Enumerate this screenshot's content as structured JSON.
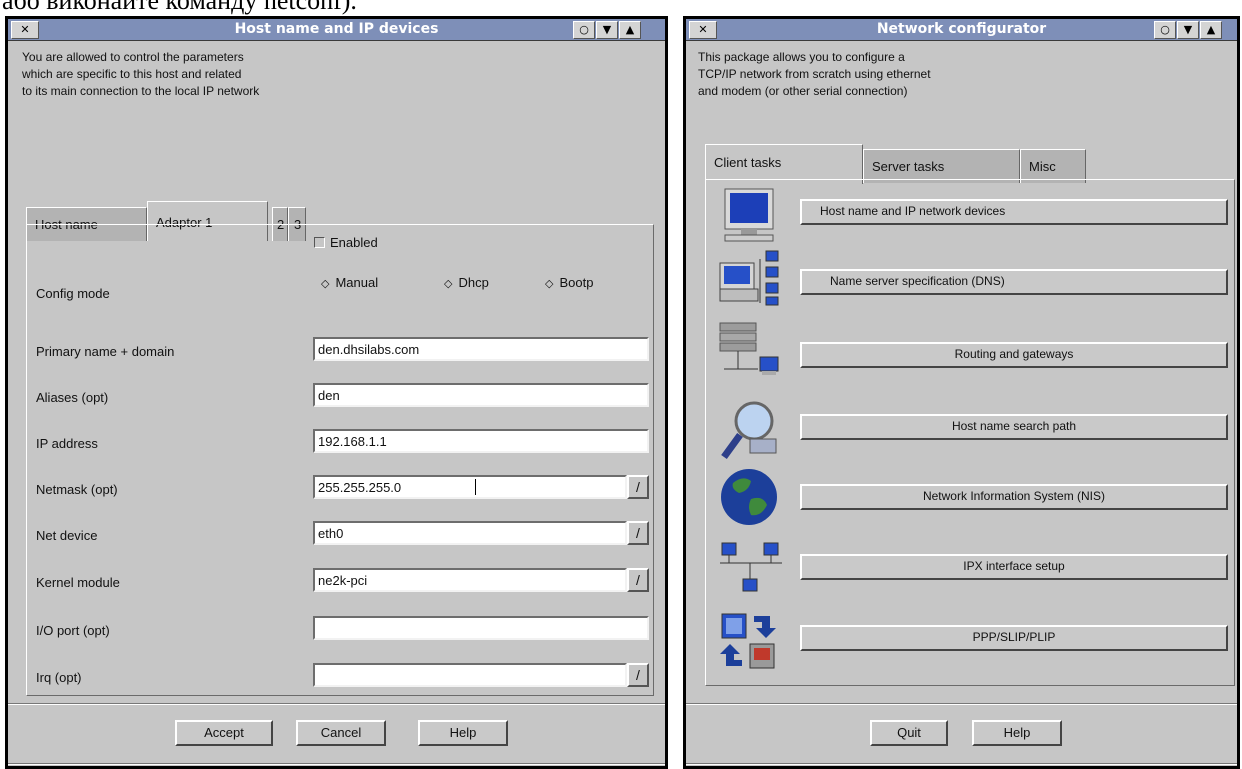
{
  "document": {
    "caption": "або виконайте команду netconf)."
  },
  "left_window": {
    "title": "Host name and IP devices",
    "close_glyph": "✕",
    "ctrl_glyphs": [
      "○",
      "▼",
      "▲"
    ],
    "intro": "You are allowed to control the parameters\nwhich are specific to this host and related\nto its main connection to the local IP network",
    "tabs": [
      "Host name",
      "Adaptor 1",
      "2",
      "3"
    ],
    "active_tab": "Adaptor 1",
    "enabled_label": "Enabled",
    "enabled_checked": false,
    "config_mode_label": "Config mode",
    "modes": [
      "Manual",
      "Dhcp",
      "Bootp"
    ],
    "selected_mode": "Manual",
    "fields": [
      {
        "label": "Primary name + domain",
        "value": ""
      },
      {
        "label": "Aliases (opt)",
        "value": "den"
      },
      {
        "label": "IP address",
        "value": "192.168.1.1"
      },
      {
        "label": "Netmask (opt)",
        "value": "255.255.255.0"
      },
      {
        "label": "Net device",
        "value": "eth0"
      },
      {
        "label": "Kernel module",
        "value": "ne2k-pci"
      },
      {
        "label": "I/O port (opt)",
        "value": ""
      },
      {
        "label": "Irq (opt)",
        "value": ""
      }
    ],
    "primary_value": "den.dhsilabs.com",
    "dropdown_glyph": "/",
    "buttons": {
      "accept": "Accept",
      "cancel": "Cancel",
      "help": "Help"
    }
  },
  "right_window": {
    "title": "Network configurator",
    "close_glyph": "✕",
    "ctrl_glyphs": [
      "○",
      "▼",
      "▲"
    ],
    "intro": "This package allows you to configure a\nTCP/IP network from scratch using ethernet\nand modem (or other serial connection)",
    "tabs": [
      "Client tasks",
      "Server tasks",
      "Misc"
    ],
    "active_tab": "Client tasks",
    "tasks": [
      {
        "label": "Host name and IP network devices",
        "icon": "monitor-icon"
      },
      {
        "label": "Name server specification (DNS)",
        "icon": "network-computers-icon"
      },
      {
        "label": "Routing and gateways",
        "icon": "router-icon"
      },
      {
        "label": "Host name search path",
        "icon": "magnifier-icon"
      },
      {
        "label": "Network Information System (NIS)",
        "icon": "globe-icon"
      },
      {
        "label": "IPX interface setup",
        "icon": "ipx-network-icon"
      },
      {
        "label": "PPP/SLIP/PLIP",
        "icon": "ppp-connection-icon"
      }
    ],
    "buttons": {
      "quit": "Quit",
      "help": "Help"
    }
  },
  "colors": {
    "titlebar": "#7e8fb8",
    "window_bg": "#c6c6c6",
    "field_bg": "#ffffff"
  }
}
